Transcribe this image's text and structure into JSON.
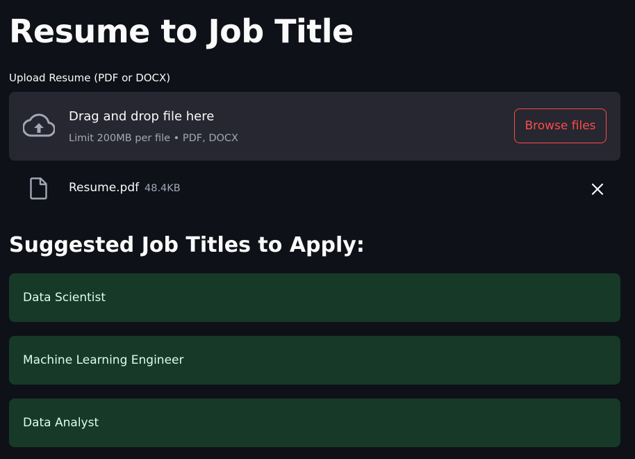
{
  "page": {
    "title": "Resume to Job Title"
  },
  "uploader": {
    "label": "Upload Resume (PDF or DOCX)",
    "drop_text": "Drag and drop file here",
    "limit_text": "Limit 200MB per file • PDF, DOCX",
    "browse_label": "Browse files",
    "icon": "cloud-upload-icon"
  },
  "uploaded_file": {
    "name": "Resume.pdf",
    "size": "48.4KB",
    "icon": "file-icon",
    "remove_icon": "close-icon"
  },
  "suggestions": {
    "heading": "Suggested Job Titles to Apply:",
    "items": [
      "Data Scientist",
      "Machine Learning Engineer",
      "Data Analyst"
    ]
  },
  "colors": {
    "background": "#0e1117",
    "dropzone": "#262730",
    "accent": "#ff4b4b",
    "success_bg": "#173928",
    "success_text": "#dffde9",
    "muted_text": "#a3a8b8"
  }
}
